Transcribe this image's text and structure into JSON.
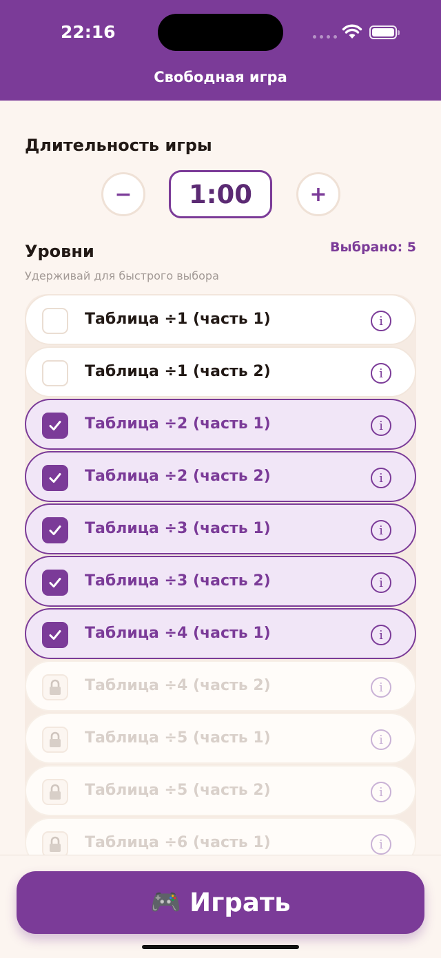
{
  "status_bar": {
    "time": "22:16"
  },
  "header": {
    "title": "Свободная игра"
  },
  "duration": {
    "label": "Длительность игры",
    "value": "1:00",
    "minus": "−",
    "plus": "+"
  },
  "levels": {
    "label": "Уровни",
    "selected_count": "Выбрано: 5",
    "hint": "Удерживай для быстрого выбора",
    "items": [
      {
        "label": "Таблица ÷1 (часть 1)",
        "state": "unchecked"
      },
      {
        "label": "Таблица ÷1 (часть 2)",
        "state": "unchecked"
      },
      {
        "label": "Таблица ÷2 (часть 1)",
        "state": "checked"
      },
      {
        "label": "Таблица ÷2 (часть 2)",
        "state": "checked"
      },
      {
        "label": "Таблица ÷3 (часть 1)",
        "state": "checked"
      },
      {
        "label": "Таблица ÷3 (часть 2)",
        "state": "checked"
      },
      {
        "label": "Таблица ÷4 (часть 1)",
        "state": "checked"
      },
      {
        "label": "Таблица ÷4 (часть 2)",
        "state": "locked"
      },
      {
        "label": "Таблица ÷5 (часть 1)",
        "state": "locked"
      },
      {
        "label": "Таблица ÷5 (часть 2)",
        "state": "locked"
      },
      {
        "label": "Таблица ÷6 (часть 1)",
        "state": "locked"
      }
    ],
    "info_icon": "info-icon",
    "check_icon": "checkmark-icon",
    "lock_icon": "lock-icon"
  },
  "play_button": {
    "label": "Играть",
    "icon": "🎮"
  },
  "colors": {
    "accent": "#7b3b98",
    "background": "#fcf5f0",
    "selected_bg": "#f1e6f7"
  }
}
